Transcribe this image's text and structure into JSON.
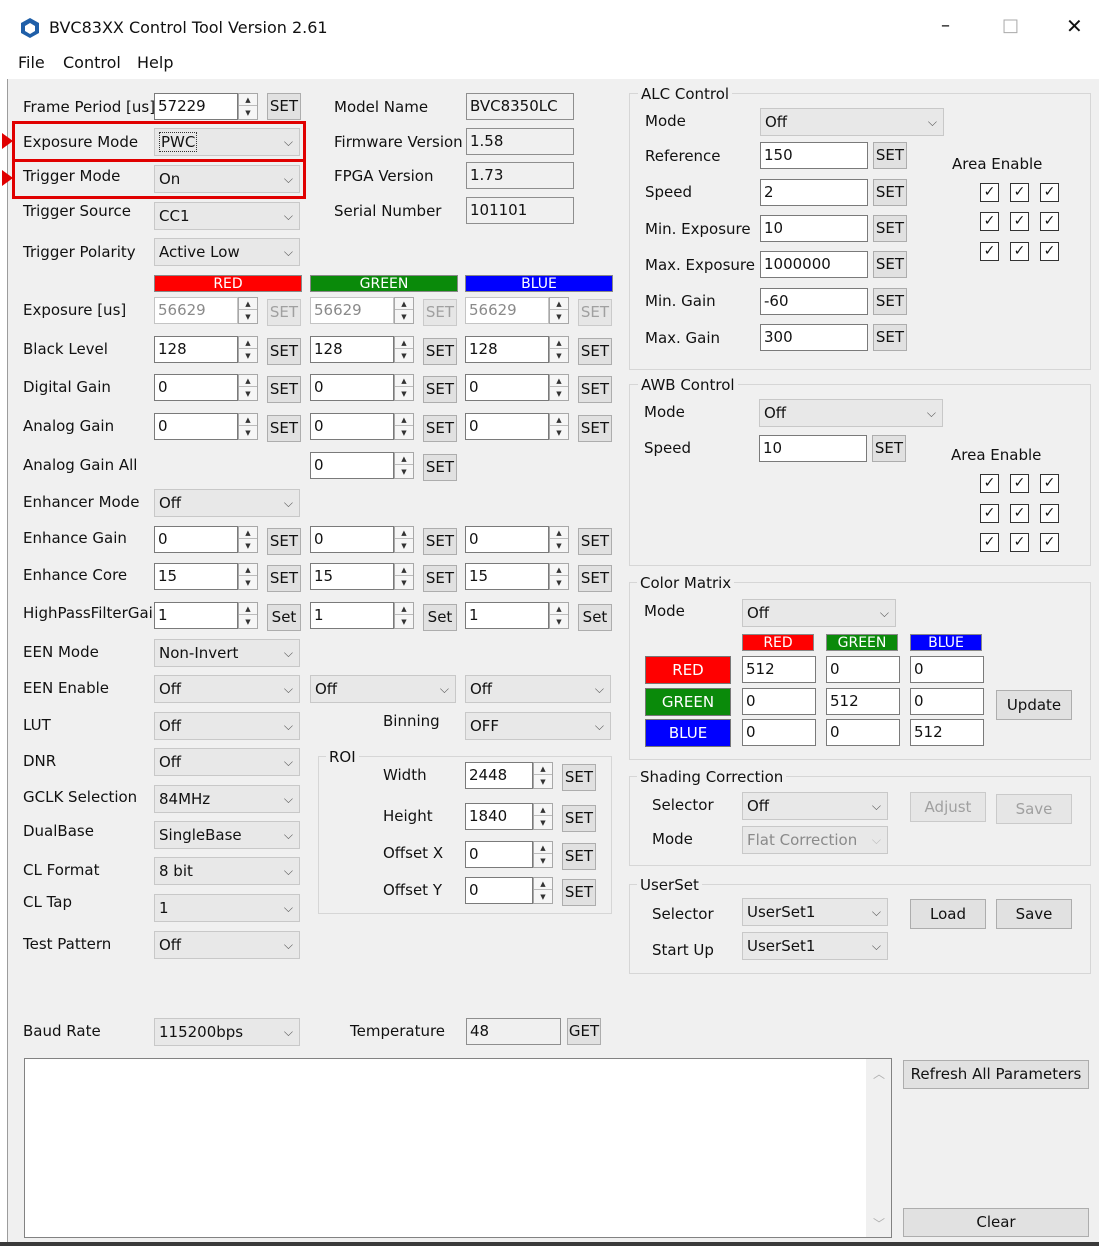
{
  "window": {
    "title": "BVC83XX Control Tool Version 2.61",
    "controls": [
      "–",
      "□",
      "✕"
    ]
  },
  "menu": [
    "File",
    "Control",
    "Help"
  ],
  "left": {
    "frame_period": {
      "label": "Frame Period [us]",
      "value": "57229",
      "set": "SET"
    },
    "exposure_mode": {
      "label": "Exposure Mode",
      "value": "PWC"
    },
    "trigger_mode": {
      "label": "Trigger Mode",
      "value": "On"
    },
    "trigger_source": {
      "label": "Trigger Source",
      "value": "CC1"
    },
    "trigger_polarity": {
      "label": "Trigger Polarity",
      "value": "Active Low"
    },
    "channels": [
      "RED",
      "GREEN",
      "BLUE"
    ],
    "exposure": {
      "label": "Exposure [us]",
      "values": [
        "56629",
        "56629",
        "56629"
      ],
      "set": "SET"
    },
    "black_level": {
      "label": "Black Level",
      "values": [
        "128",
        "128",
        "128"
      ],
      "set": "SET"
    },
    "digital_gain": {
      "label": "Digital Gain",
      "values": [
        "0",
        "0",
        "0"
      ],
      "set": "SET"
    },
    "analog_gain": {
      "label": "Analog Gain",
      "values": [
        "0",
        "0",
        "0"
      ],
      "set": "SET"
    },
    "analog_gain_all": {
      "label": "Analog Gain All",
      "value": "0",
      "set": "SET"
    },
    "enhancer_mode": {
      "label": "Enhancer Mode",
      "value": "Off"
    },
    "enhance_gain": {
      "label": "Enhance Gain",
      "values": [
        "0",
        "0",
        "0"
      ],
      "set": "SET"
    },
    "enhance_core": {
      "label": "Enhance Core",
      "values": [
        "15",
        "15",
        "15"
      ],
      "set": "SET"
    },
    "hpf_gain": {
      "label": "HighPassFilterGain",
      "values": [
        "1",
        "1",
        "1"
      ],
      "set": "Set"
    },
    "een_mode": {
      "label": "EEN Mode",
      "value": "Non-Invert"
    },
    "een_enable": {
      "label": "EEN Enable",
      "values": [
        "Off",
        "Off",
        "Off"
      ]
    },
    "lut": {
      "label": "LUT",
      "value": "Off"
    },
    "binning": {
      "label": "Binning",
      "value": "OFF"
    },
    "dnr": {
      "label": "DNR",
      "value": "Off"
    },
    "gclk": {
      "label": "GCLK Selection",
      "value": "84MHz"
    },
    "dualbase": {
      "label": "DualBase",
      "value": "SingleBase"
    },
    "cl_format": {
      "label": "CL Format",
      "value": "8 bit"
    },
    "cl_tap": {
      "label": "CL Tap",
      "value": "1"
    },
    "test_pattern": {
      "label": "Test Pattern",
      "value": "Off"
    },
    "baud_rate": {
      "label": "Baud Rate",
      "value": "115200bps"
    }
  },
  "info": {
    "model_name": {
      "label": "Model Name",
      "value": "BVC8350LC"
    },
    "firmware": {
      "label": "Firmware Version",
      "value": "1.58"
    },
    "fpga": {
      "label": "FPGA Version",
      "value": "1.73"
    },
    "serial": {
      "label": "Serial Number",
      "value": "101101"
    },
    "temperature": {
      "label": "Temperature",
      "value": "48",
      "get": "GET"
    }
  },
  "roi": {
    "title": "ROI",
    "width": {
      "label": "Width",
      "value": "2448"
    },
    "height": {
      "label": "Height",
      "value": "1840"
    },
    "offset_x": {
      "label": "Offset X",
      "value": "0"
    },
    "offset_y": {
      "label": "Offset Y",
      "value": "0"
    },
    "set": "SET"
  },
  "alc": {
    "title": "ALC Control",
    "mode": {
      "label": "Mode",
      "value": "Off"
    },
    "reference": {
      "label": "Reference",
      "value": "150"
    },
    "speed": {
      "label": "Speed",
      "value": "2"
    },
    "min_exposure": {
      "label": "Min. Exposure",
      "value": "10"
    },
    "max_exposure": {
      "label": "Max. Exposure",
      "value": "1000000"
    },
    "min_gain": {
      "label": "Min. Gain",
      "value": "-60"
    },
    "max_gain": {
      "label": "Max. Gain",
      "value": "300"
    },
    "set": "SET",
    "area_enable": "Area Enable"
  },
  "awb": {
    "title": "AWB Control",
    "mode": {
      "label": "Mode",
      "value": "Off"
    },
    "speed": {
      "label": "Speed",
      "value": "10"
    },
    "set": "SET",
    "area_enable": "Area Enable"
  },
  "color_matrix": {
    "title": "Color Matrix",
    "mode": {
      "label": "Mode",
      "value": "Off"
    },
    "columns": [
      "RED",
      "GREEN",
      "BLUE"
    ],
    "rows": [
      {
        "label": "RED",
        "values": [
          "512",
          "0",
          "0"
        ]
      },
      {
        "label": "GREEN",
        "values": [
          "0",
          "512",
          "0"
        ]
      },
      {
        "label": "BLUE",
        "values": [
          "0",
          "0",
          "512"
        ]
      }
    ],
    "update": "Update"
  },
  "shading": {
    "title": "Shading Correction",
    "selector": {
      "label": "Selector",
      "value": "Off"
    },
    "mode": {
      "label": "Mode",
      "value": "Flat Correction"
    },
    "adjust": "Adjust",
    "save": "Save"
  },
  "userset": {
    "title": "UserSet",
    "selector": {
      "label": "Selector",
      "value": "UserSet1"
    },
    "startup": {
      "label": "Start Up",
      "value": "UserSet1"
    },
    "load": "Load",
    "save": "Save"
  },
  "bottom": {
    "refresh": "Refresh All Parameters",
    "clear": "Clear"
  },
  "checkmark": "✓",
  "colors": {
    "red": "#ff0000",
    "green": "#0a8a0a",
    "blue": "#0000ff",
    "highlight": "#e00000"
  }
}
